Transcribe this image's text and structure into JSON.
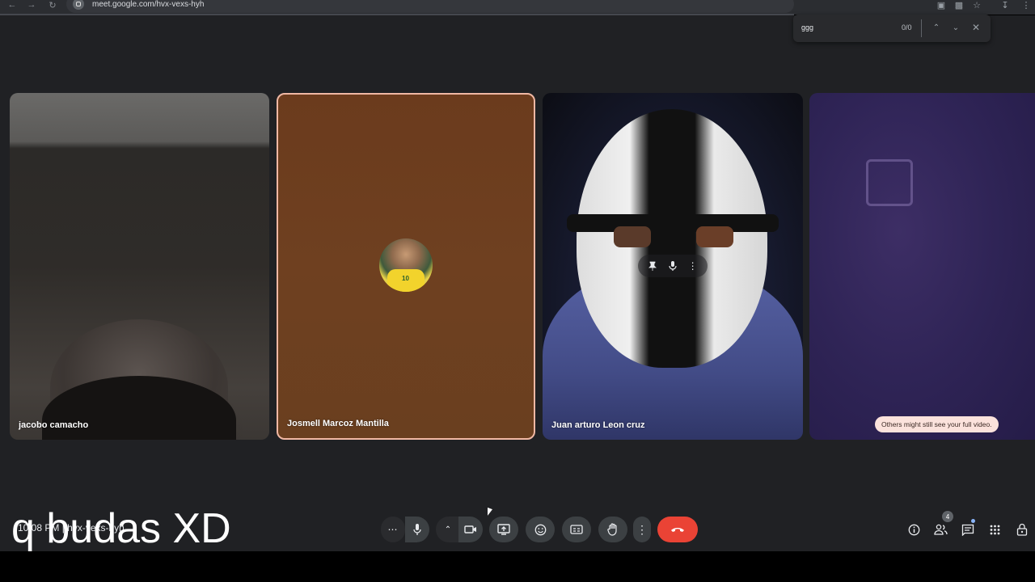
{
  "browser": {
    "url": "meet.google.com/hvx-vexs-hyh",
    "nav_icons": [
      "back-icon",
      "forward-icon",
      "reload-icon"
    ],
    "extension_icons": [
      "translate-icon",
      "extension-icon",
      "star-icon",
      "download-icon",
      "menu-icon"
    ]
  },
  "find_bar": {
    "query": "ggg",
    "count": "0/0"
  },
  "participants": [
    {
      "name": "jacobo camacho"
    },
    {
      "name": "Josmell Marcoz Mantilla",
      "active": true,
      "avatar_number": "10"
    },
    {
      "name": "Juan arturo Leon cruz"
    },
    {
      "name": "",
      "notice": "Others might still see your full video."
    }
  ],
  "meeting_info": "10:08 PM | hvx-vexs-hyh",
  "overlay_text": "q budas XD",
  "controls": {
    "people_count": "4",
    "icons": [
      "more-options-icon",
      "mic-icon",
      "chevron-up-icon",
      "camera-icon",
      "present-icon",
      "emoji-icon",
      "captions-icon",
      "raise-hand-icon",
      "more-vert-icon",
      "end-call-icon"
    ],
    "right_icons": [
      "info-icon",
      "people-icon",
      "chat-icon",
      "activities-icon",
      "host-controls-icon"
    ]
  },
  "colors": {
    "meet_bg": "#202124",
    "button_bg": "#3c4043",
    "end_call": "#ea4335",
    "active_border": "#f0b8a4"
  }
}
